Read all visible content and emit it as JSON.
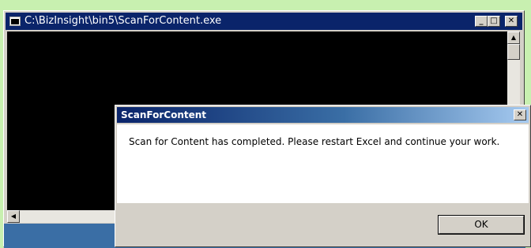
{
  "console_window": {
    "title": "C:\\BizInsight\\bin5\\ScanForContent.exe",
    "icon": "console-app-icon",
    "buttons": {
      "minimize": "_",
      "maximize": "□",
      "close": "✕"
    },
    "scroll_up": "▲",
    "scroll_left": "◀"
  },
  "dialog": {
    "title": "ScanForContent",
    "close": "✕",
    "message": "Scan for Content has completed. Please restart Excel and continue your work.",
    "ok_label": "OK"
  },
  "colors": {
    "desktop": "#c8f0b0",
    "title_active": "#0a246a",
    "window_face": "#d4d0c8",
    "console_bg": "#000000"
  }
}
